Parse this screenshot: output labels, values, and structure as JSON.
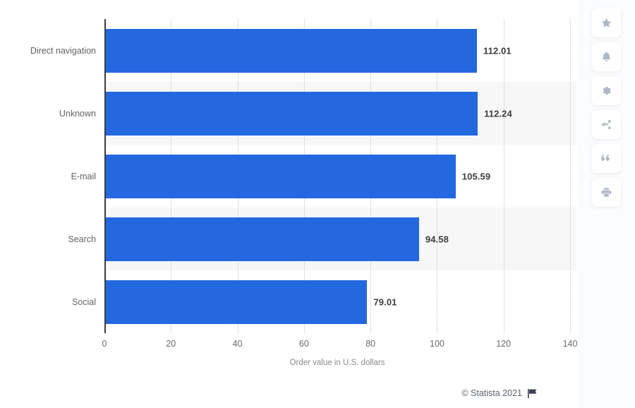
{
  "chart_data": {
    "type": "bar",
    "orientation": "horizontal",
    "title": "",
    "subtitle": "",
    "xlabel": "Order value in U.S. dollars",
    "ylabel": "",
    "categories": [
      "Direct navigation",
      "Unknown",
      "E-mail",
      "Search",
      "Social"
    ],
    "values": [
      112.01,
      112.24,
      105.59,
      94.58,
      79.01
    ],
    "value_labels": [
      "112.01",
      "112.24",
      "105.59",
      "94.58",
      "79.01"
    ],
    "series": [
      {
        "name": "Order value in U.S. dollars",
        "values": [
          112.01,
          112.24,
          105.59,
          94.58,
          79.01
        ],
        "color": "#2468df"
      }
    ],
    "xlim": [
      0,
      140
    ],
    "xticks": [
      0,
      20,
      40,
      60,
      80,
      100,
      120,
      140
    ],
    "xtick_labels": [
      "0",
      "20",
      "40",
      "60",
      "80",
      "100",
      "120",
      "140"
    ],
    "grid": true,
    "grid_style": "dotted-vertical",
    "legend": false,
    "legend_position": "none",
    "zebra_rows": [
      false,
      true,
      false,
      true,
      false
    ],
    "bar_color": "#2468df",
    "label_color": "#3d3d3d",
    "axis_color": "#3c3c3c"
  },
  "footer": {
    "copyright": "© Statista 2021",
    "flag_icon": "flag-icon"
  },
  "icon_rail": {
    "buttons": [
      {
        "name": "favorite-button",
        "icon": "star-icon"
      },
      {
        "name": "notifications-button",
        "icon": "bell-icon"
      },
      {
        "name": "settings-button",
        "icon": "gear-icon"
      },
      {
        "name": "share-button",
        "icon": "share-icon"
      },
      {
        "name": "citation-button",
        "icon": "quote-icon"
      },
      {
        "name": "print-button",
        "icon": "print-icon"
      }
    ]
  }
}
